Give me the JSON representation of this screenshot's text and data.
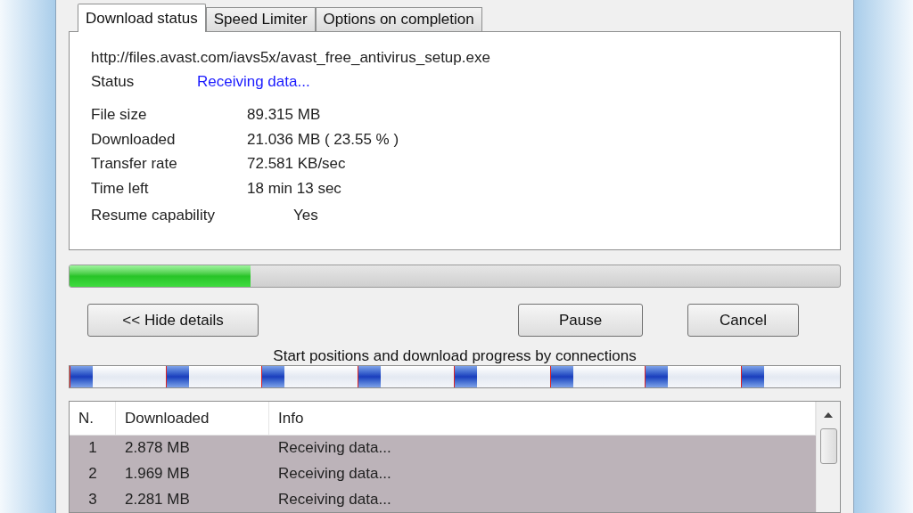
{
  "tabs": [
    {
      "label": "Download status",
      "selected": true
    },
    {
      "label": "Speed Limiter",
      "selected": false
    },
    {
      "label": "Options on completion",
      "selected": false
    }
  ],
  "url": "http://files.avast.com/iavs5x/avast_free_antivirus_setup.exe",
  "status": {
    "label": "Status",
    "value": "Receiving data..."
  },
  "details": [
    {
      "label": "File size",
      "value": "89.315  MB"
    },
    {
      "label": "Downloaded",
      "value": "21.036  MB  ( 23.55 % )"
    },
    {
      "label": "Transfer rate",
      "value": "72.581  KB/sec"
    },
    {
      "label": "Time left",
      "value": "18 min 13 sec"
    }
  ],
  "resume": {
    "label": "Resume capability",
    "value": "Yes"
  },
  "progress": {
    "level": 0.2355
  },
  "buttons": [
    {
      "label": "<< Hide details"
    },
    {
      "label": "Pause"
    },
    {
      "label": "Cancel"
    }
  ],
  "connections_caption": "Start positions and download progress by connections",
  "table": {
    "columns": [
      "N.",
      "Downloaded",
      "Info"
    ],
    "rows": [
      {
        "cells": [
          "1",
          "2.878  MB",
          "Receiving data..."
        ],
        "selected": true
      },
      {
        "cells": [
          "2",
          "1.969  MB",
          "Receiving data..."
        ],
        "selected": true
      },
      {
        "cells": [
          "3",
          "2.281  MB",
          "Receiving data..."
        ],
        "selected": true
      }
    ]
  }
}
